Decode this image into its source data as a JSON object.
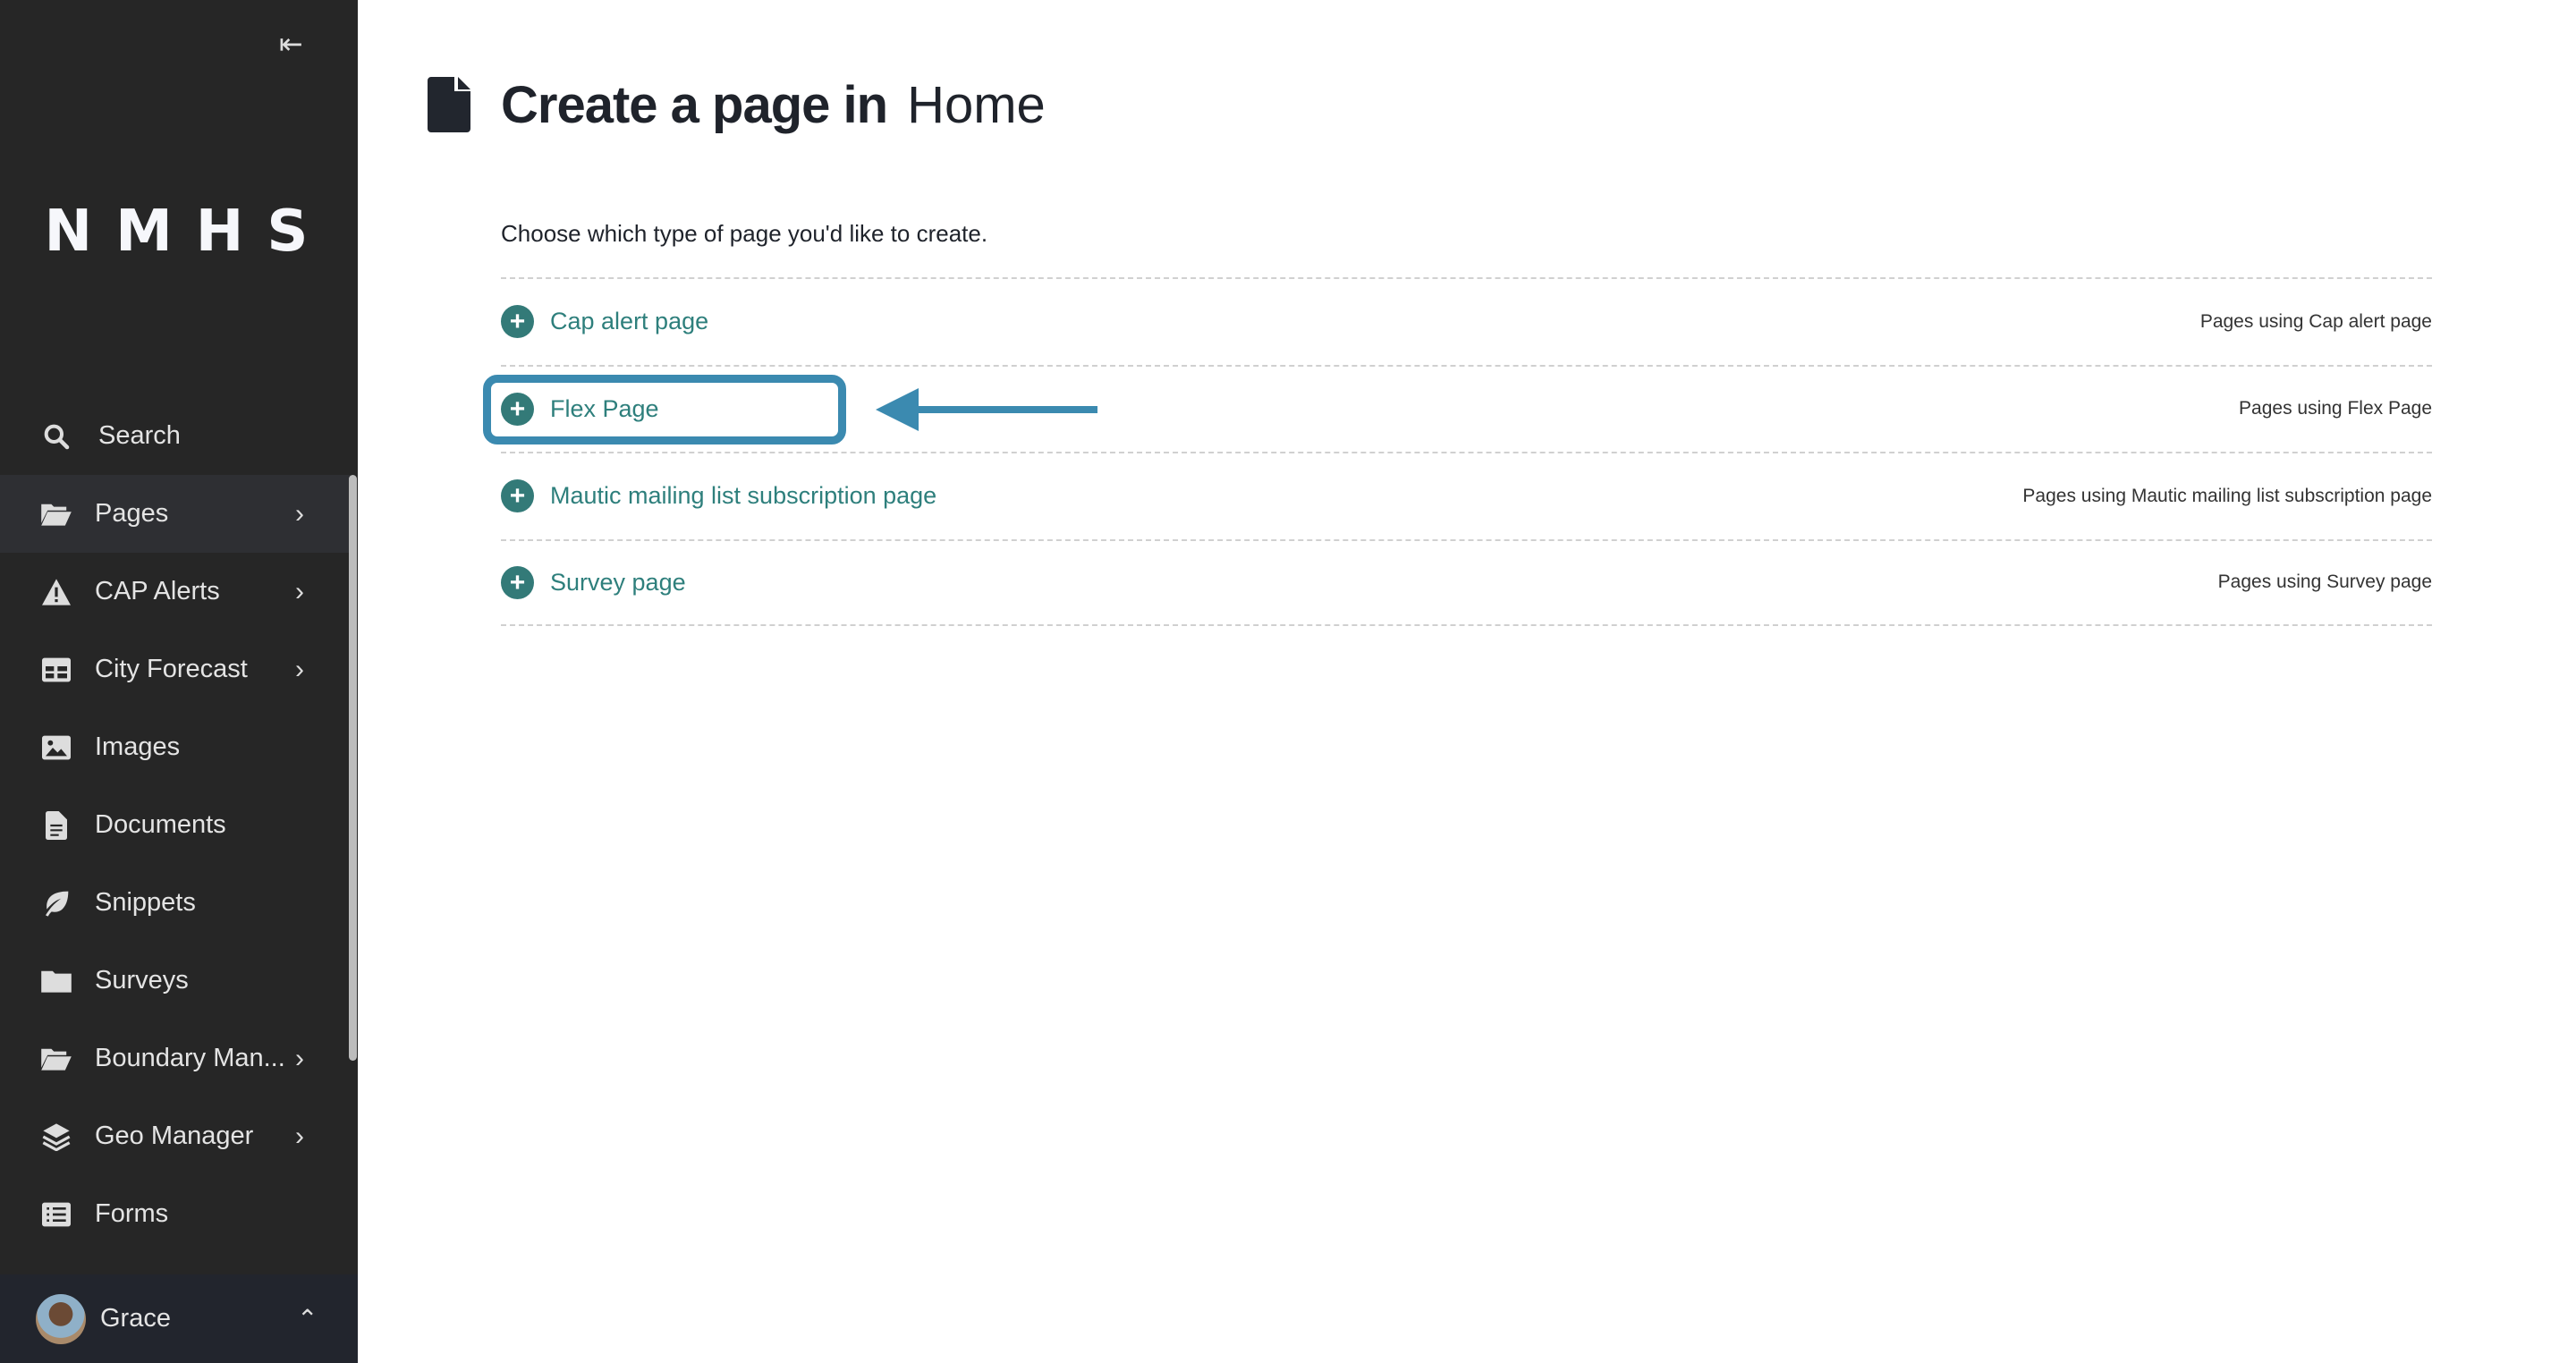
{
  "sidebar": {
    "collapse_icon": "collapse-left-icon",
    "logo": "NMHS",
    "items": [
      {
        "label": "Search",
        "icon": "search-icon",
        "chevron": false
      },
      {
        "label": "Pages",
        "icon": "folder-open-icon",
        "chevron": true,
        "active": true
      },
      {
        "label": "CAP Alerts",
        "icon": "warning-icon",
        "chevron": true
      },
      {
        "label": "City Forecast",
        "icon": "table-icon",
        "chevron": true
      },
      {
        "label": "Images",
        "icon": "image-icon",
        "chevron": false
      },
      {
        "label": "Documents",
        "icon": "document-icon",
        "chevron": false
      },
      {
        "label": "Snippets",
        "icon": "leaf-icon",
        "chevron": false
      },
      {
        "label": "Surveys",
        "icon": "folder-icon",
        "chevron": false
      },
      {
        "label": "Boundary Man...",
        "icon": "folder-open-icon",
        "chevron": true
      },
      {
        "label": "Geo Manager",
        "icon": "layers-icon",
        "chevron": true
      },
      {
        "label": "Forms",
        "icon": "list-icon",
        "chevron": false
      }
    ],
    "user": {
      "name": "Grace"
    }
  },
  "main": {
    "title_bold": "Create a page in",
    "title_location": "Home",
    "intro": "Choose which type of page you'd like to create.",
    "page_types": [
      {
        "label": "Cap alert page",
        "meta": "Pages using Cap alert page"
      },
      {
        "label": "Flex Page",
        "meta": "Pages using Flex Page"
      },
      {
        "label": "Mautic mailing list subscription page",
        "meta": "Pages using Mautic mailing list subscription page"
      },
      {
        "label": "Survey page",
        "meta": "Pages using Survey page"
      }
    ]
  },
  "colors": {
    "sidebar_bg": "#262626",
    "accent": "#337a78",
    "highlight": "#3b8ab0"
  }
}
